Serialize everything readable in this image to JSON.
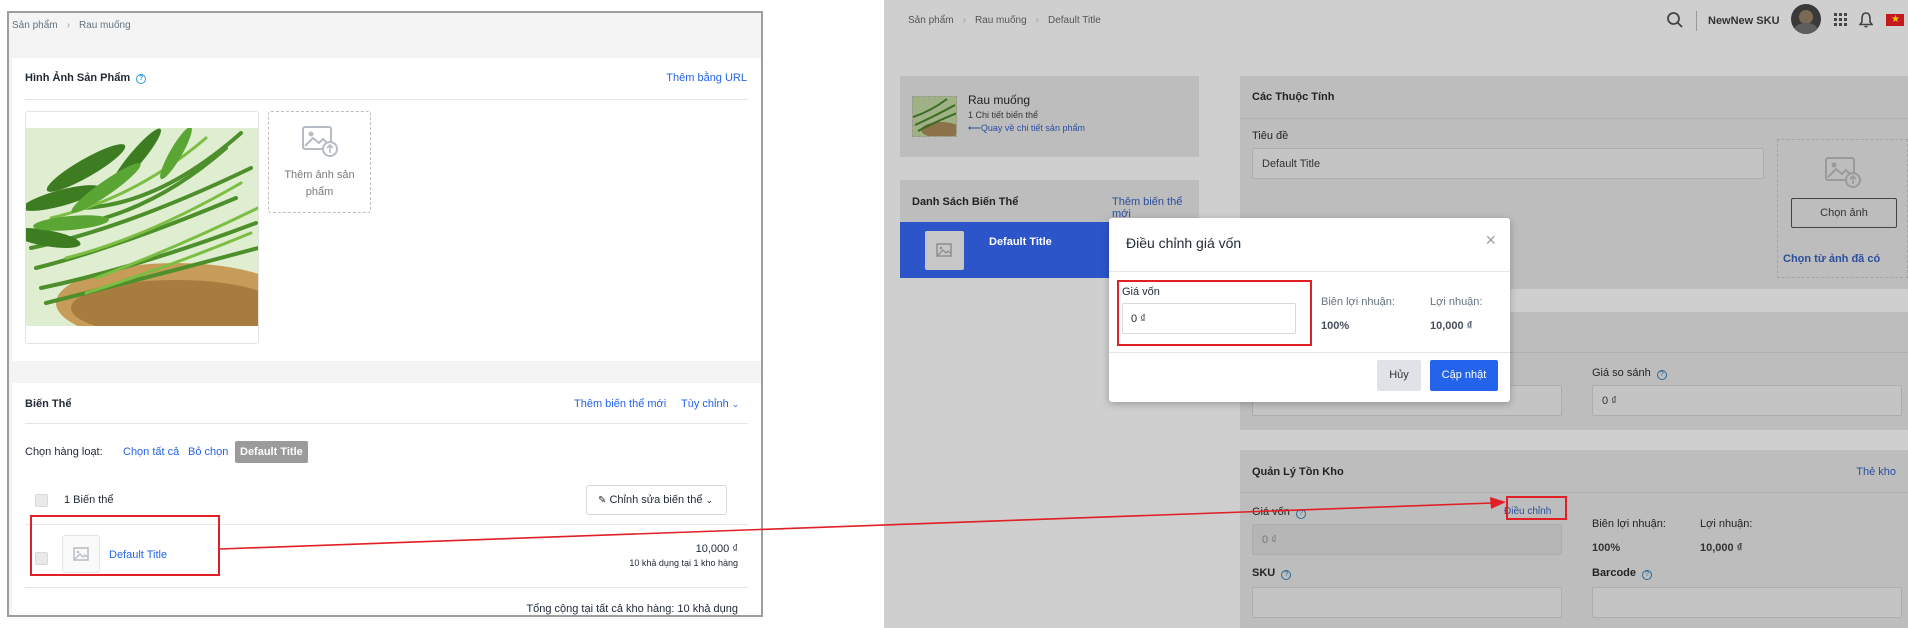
{
  "left": {
    "breadcrumb": [
      "Sản phẩm",
      "Rau muống"
    ],
    "images": {
      "title": "Hình Ảnh Sản Phẩm",
      "add_by_url": "Thêm bằng URL",
      "add_image_line1": "Thêm ảnh sản",
      "add_image_line2": "phẩm"
    },
    "variants": {
      "title": "Biến Thể",
      "add_new": "Thêm biến thể mới",
      "customize": "Tùy chỉnh",
      "bulk_label": "Chọn hàng loạt:",
      "select_all": "Chọn tất cả",
      "deselect": "Bỏ chọn",
      "tag": "Default Title",
      "count": "1 Biến thể",
      "edit_variant": "Chỉnh sửa biến thể",
      "row": {
        "name": "Default Title",
        "price": "10,000 ₫",
        "stock": "10 khả dụng tại 1 kho hàng"
      },
      "total": "Tổng cộng tại tất cả kho hàng: 10 khả dụng"
    }
  },
  "right": {
    "breadcrumb": [
      "Sản phẩm",
      "Rau muống",
      "Default Title"
    ],
    "header": {
      "store_name": "NewNew SKU"
    },
    "product": {
      "name": "Rau muống",
      "detail_count": "1 Chi tiết biến thể",
      "back_link": "Quay về chi tiết sản phẩm"
    },
    "variant_list": {
      "title": "Danh Sách Biến Thể",
      "add_new": "Thêm biến thể mới",
      "selected_item": "Default Title"
    },
    "attributes": {
      "title": "Các Thuộc Tính",
      "title_label": "Tiêu đề",
      "title_value": "Default Title",
      "choose_image": "Chọn ảnh",
      "choose_existing": "Chọn từ ảnh đã có"
    },
    "pricing": {
      "compare_label": "Giá so sánh",
      "compare_value": "0 ₫"
    },
    "inventory": {
      "title": "Quản Lý Tồn Kho",
      "manage_link": "Thẻ kho",
      "cost_label": "Giá vốn",
      "adjust_link": "Điều chỉnh",
      "cost_value": "0 ₫",
      "margin_label": "Biên lợi nhuận:",
      "margin_value": "100%",
      "profit_label": "Lợi nhuận:",
      "profit_value": "10,000 ₫",
      "sku_label": "SKU",
      "barcode_label": "Barcode"
    }
  },
  "modal": {
    "title": "Điều chỉnh giá vốn",
    "cost_label": "Giá vốn",
    "cost_value": "0 ₫",
    "margin_label": "Biên lợi nhuận:",
    "margin_value": "100%",
    "profit_label": "Lợi nhuận:",
    "profit_value": "10,000 ₫",
    "cancel": "Hủy",
    "update": "Cập nhật"
  },
  "colors": {
    "link": "#2463eb",
    "primary_button": "#2463eb",
    "selected_variant": "#2b55c9",
    "annotation_red": "#e01f26"
  }
}
